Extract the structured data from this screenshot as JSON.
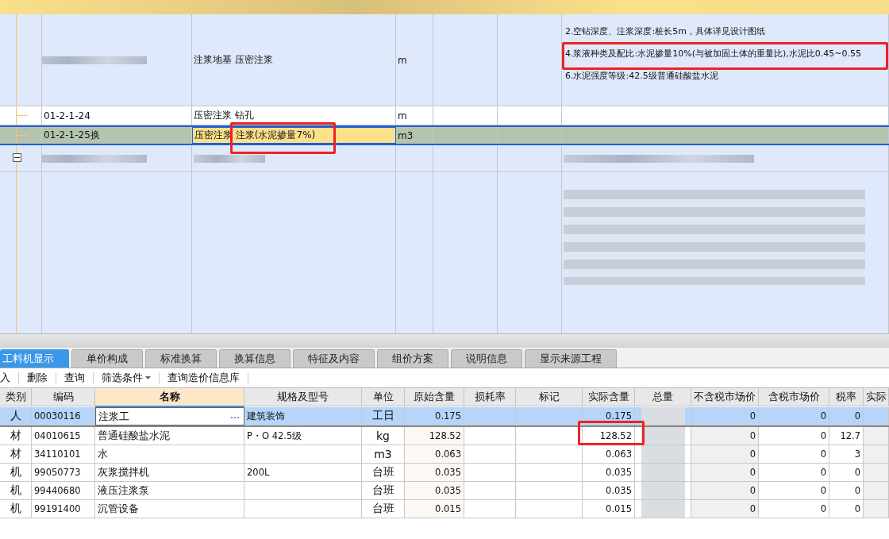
{
  "top_grid": {
    "rows": [
      {
        "kind": "item",
        "code": "",
        "name": "注浆地基 压密注浆",
        "unit": "m",
        "selected": false,
        "description": [
          "2.空钻深度、注浆深度:桩长5m，具体详见设计图纸",
          "4.浆液种类及配比:水泥掺量10%(与被加固土体的重量比),水泥比0.45~0.55",
          "6.水泥强度等级:42.5级普通硅酸盐水泥"
        ]
      },
      {
        "kind": "sub",
        "code": "01-2-1-24",
        "name": "压密注浆 钻孔",
        "unit": "m",
        "selected": false
      },
      {
        "kind": "sub",
        "code": "01-2-1-25换",
        "name": "压密注浆 注浆(水泥掺量7%)",
        "unit": "m3",
        "selected": true
      },
      {
        "kind": "group",
        "expanded": true
      }
    ]
  },
  "tabs": [
    {
      "label": "工料机显示",
      "selected": true
    },
    {
      "label": "单价构成",
      "selected": false
    },
    {
      "label": "标准换算",
      "selected": false
    },
    {
      "label": "换算信息",
      "selected": false
    },
    {
      "label": "特征及内容",
      "selected": false
    },
    {
      "label": "组价方案",
      "selected": false
    },
    {
      "label": "说明信息",
      "selected": false
    },
    {
      "label": "显示来源工程",
      "selected": false
    }
  ],
  "toolbar": [
    {
      "kind": "button",
      "label": "入"
    },
    {
      "kind": "button",
      "label": "删除"
    },
    {
      "kind": "button",
      "label": "查询"
    },
    {
      "kind": "dropdown",
      "label": "筛选条件"
    },
    {
      "kind": "button",
      "label": "查询造价信息库"
    }
  ],
  "table": {
    "columns": [
      {
        "label": "类别",
        "selected": false
      },
      {
        "label": "编码",
        "selected": false
      },
      {
        "label": "名称",
        "selected": true
      },
      {
        "label": "规格及型号",
        "selected": false
      },
      {
        "label": "单位",
        "selected": false
      },
      {
        "label": "原始含量",
        "selected": false
      },
      {
        "label": "损耗率",
        "selected": false
      },
      {
        "label": "标记",
        "selected": false
      },
      {
        "label": "实际含量",
        "selected": false
      },
      {
        "label": "总量",
        "selected": false
      },
      {
        "label": "不含税市场价",
        "selected": false
      },
      {
        "label": "含税市场价",
        "selected": false
      },
      {
        "label": "税率",
        "selected": false
      },
      {
        "label": "实际",
        "selected": false
      }
    ],
    "rows": [
      {
        "selected": true,
        "cells": [
          "人",
          "00030116",
          "注浆工",
          "建筑装饰",
          "工日",
          "0.175",
          "",
          "",
          "0.175",
          "",
          "0",
          "0",
          "0",
          ""
        ]
      },
      {
        "selected": false,
        "cells": [
          "材",
          "04010615",
          "普通硅酸盐水泥",
          "P・O 42.5级",
          "kg",
          "128.52",
          "",
          "",
          "128.52",
          "",
          "0",
          "0",
          "12.7",
          ""
        ]
      },
      {
        "selected": false,
        "cells": [
          "材",
          "34110101",
          "水",
          "",
          "m3",
          "0.063",
          "",
          "",
          "0.063",
          "",
          "0",
          "0",
          "3",
          ""
        ]
      },
      {
        "selected": false,
        "cells": [
          "机",
          "99050773",
          "灰浆搅拌机",
          "200L",
          "台班",
          "0.035",
          "",
          "",
          "0.035",
          "",
          "0",
          "0",
          "0",
          ""
        ]
      },
      {
        "selected": false,
        "cells": [
          "机",
          "99440680",
          "液压注浆泵",
          "",
          "台班",
          "0.035",
          "",
          "",
          "0.035",
          "",
          "0",
          "0",
          "0",
          ""
        ]
      },
      {
        "selected": false,
        "cells": [
          "机",
          "99191400",
          "沉管设备",
          "",
          "台班",
          "0.015",
          "",
          "",
          "0.015",
          "",
          "0",
          "0",
          "0",
          ""
        ]
      }
    ]
  }
}
